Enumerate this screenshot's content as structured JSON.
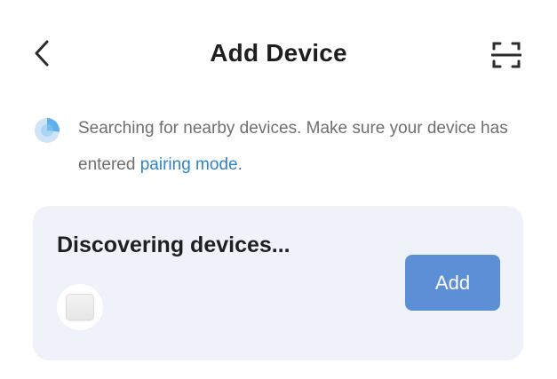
{
  "header": {
    "title": "Add Device",
    "back_icon": "chevron-left-icon",
    "scan_icon": "scan-frame-icon"
  },
  "notice": {
    "text_before_link": "Searching for nearby devices. Make sure your device has entered ",
    "link_text": "pairing mode",
    "text_after_link": ".",
    "spinner_icon": "loading-spinner-icon"
  },
  "discovery_card": {
    "title": "Discovering devices...",
    "add_label": "Add",
    "device_icon": "smart-device-icon"
  },
  "colors": {
    "accent_blue": "#2f84c9",
    "button_blue": "#5c8fd6",
    "card_bg": "#eff2f8",
    "spinner_light": "#cfe5f7",
    "spinner_dark": "#5fb0ea"
  }
}
